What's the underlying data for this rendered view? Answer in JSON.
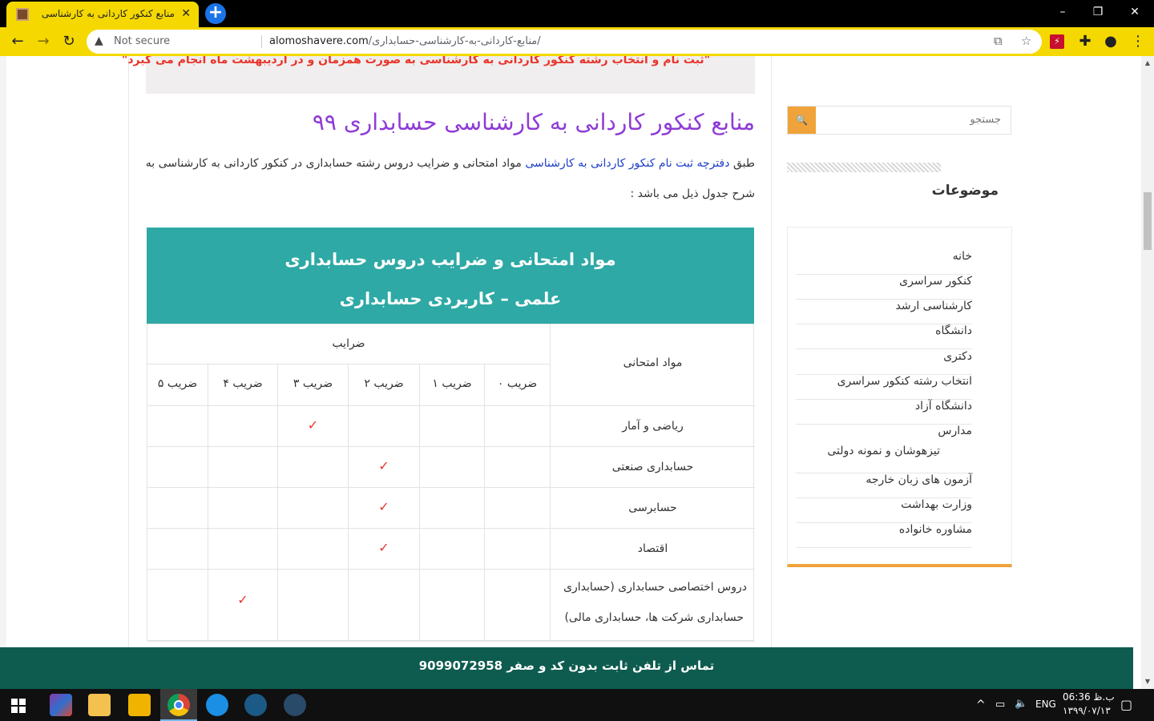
{
  "browser": {
    "tab_title": "منابع کنکور کاردانی به کارشناسی حسابداری",
    "tab_close": "✕",
    "new_tab": "+",
    "window_controls": {
      "minimize": "–",
      "maximize": "❐",
      "close": "✕"
    },
    "nav": {
      "back": "←",
      "forward": "→",
      "reload": "↻"
    },
    "security_label": "Not secure",
    "warning_glyph": "▲",
    "url_host": "alomoshavere.com",
    "url_path": "/منابع-کاردانی-به-کارشناسی-حسابداری/",
    "icons": [
      "translate-icon",
      "star-icon",
      "extension-icon",
      "puzzle-icon",
      "profile-icon",
      "menu-icon"
    ]
  },
  "page": {
    "notice": "\"ثبت نام و انتخاب رشته کنکور کاردانی به کارشناسی به صورت همزمان و در اردیبهشت ماه انجام می گیرد\"",
    "article_title": "منابع کنکور کاردانی به کارشناسی حسابداری ۹۹",
    "intro": {
      "line1_prefix": "طبق ",
      "line1_link": "دفترچه ثبت نام کنکور کاردانی به کارشناسی",
      "line1_suffix": " مواد امتحانی و ضرایب دروس رشته حسابداری در کنکور کاردانی به کارشناسی به",
      "line2": "شرح جدول ذیل می باشد :"
    },
    "table": {
      "title_line1": "مواد امتحانی و ضرایب دروس حسابداری",
      "title_line2": "علمی – کاربردی حسابداری",
      "header_subject": "مواد امتحانی",
      "header_coeff": "ضرایب",
      "coeff_columns": [
        "ضریب ۰",
        "ضریب ۱",
        "ضریب ۲",
        "ضریب ۳",
        "ضریب ۴",
        "ضریب ۵"
      ],
      "check_glyph": "✓",
      "rows": [
        {
          "subject": "ریاضی و آمار",
          "coeff_index": 3
        },
        {
          "subject": "حسابداری صنعتی",
          "coeff_index": 2
        },
        {
          "subject": "حسابرسی",
          "coeff_index": 2
        },
        {
          "subject": "اقتصاد",
          "coeff_index": 2
        },
        {
          "subject_line1": "دروس اختصاصی حسابداری (حسابداری",
          "subject_line2": "حسابداری شرکت ها، حسابداری مالی)",
          "coeff_index": 4
        }
      ]
    }
  },
  "sidebar": {
    "search_placeholder": "جستجو",
    "search_button": "🔍",
    "topics_title": "موضوعات",
    "menu": [
      "خانه",
      "کنکور سراسری",
      "کارشناسی ارشد",
      "دانشگاه",
      "دکتری",
      "انتخاب رشته کنکور سراسری",
      "دانشگاه آزاد",
      "مدارس",
      "تیزهوشان و نمونه دولتی",
      "آزمون های زبان خارجه",
      "وزارت بهداشت",
      "مشاوره خانواده"
    ]
  },
  "footer": {
    "contact": "تماس از تلفن ثابت بدون کد و صفر 9099072958"
  },
  "taskbar": {
    "apps": [
      "start-icon",
      "winrar-icon",
      "file-explorer-icon",
      "kmplayer-icon",
      "chrome-icon",
      "uplay-icon",
      "steam-icon",
      "teamspeak-icon"
    ],
    "language": "ENG",
    "time": "06:36 ب.ظ",
    "date": "۱۳۹۹/۰۷/۱۳",
    "tray_up": "^"
  },
  "colors": {
    "chrome_accent": "#f5d800",
    "title_purple": "#8e3bd6",
    "table_header": "#2ea9a5",
    "check_red": "#e8352b",
    "footer_green": "#0e5c4f",
    "sidebar_orange": "#f0a33a"
  }
}
